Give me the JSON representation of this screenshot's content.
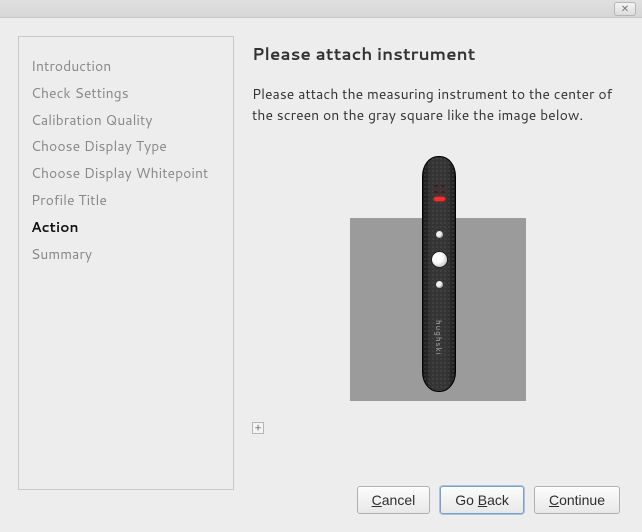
{
  "sidebar": {
    "items": [
      {
        "label": "Introduction",
        "active": false
      },
      {
        "label": "Check Settings",
        "active": false
      },
      {
        "label": "Calibration Quality",
        "active": false
      },
      {
        "label": "Choose Display Type",
        "active": false
      },
      {
        "label": "Choose Display Whitepoint",
        "active": false
      },
      {
        "label": "Profile Title",
        "active": false
      },
      {
        "label": "Action",
        "active": true
      },
      {
        "label": "Summary",
        "active": false
      }
    ]
  },
  "main": {
    "heading": "Please attach instrument",
    "description": "Please attach the measuring instrument to the center of the screen on the gray square like the image below.",
    "instrument_brand": "hughski"
  },
  "buttons": {
    "cancel": "Cancel",
    "back": "Go Back",
    "continue": "Continue"
  },
  "icons": {
    "close": "✕",
    "expand": "+"
  }
}
